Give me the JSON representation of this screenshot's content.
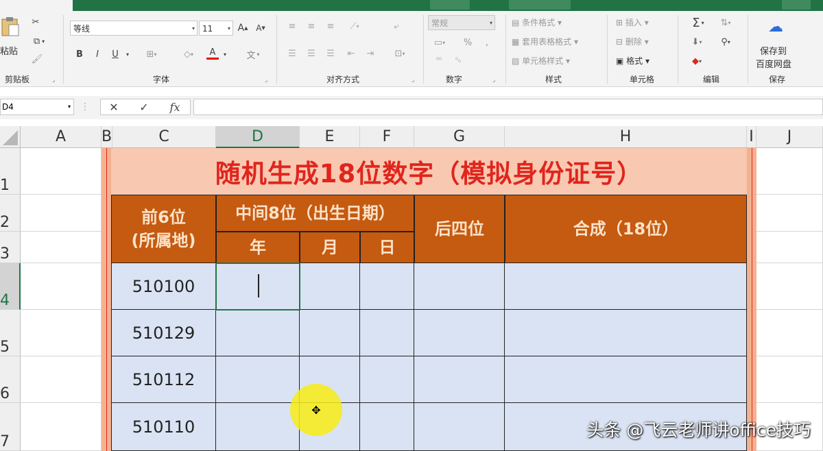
{
  "ribbon": {
    "clipboard": {
      "paste_label": "粘贴",
      "group_label": "剪贴板"
    },
    "font": {
      "font_name": "等线",
      "font_size": "11",
      "group_label": "字体",
      "bold": "B",
      "italic": "I",
      "underline": "U",
      "grow": "A",
      "shrink": "A",
      "font_color_letter": "A",
      "pinyin": "文"
    },
    "alignment": {
      "group_label": "对齐方式"
    },
    "number": {
      "format_value": "常规",
      "percent": "%",
      "comma": ",",
      "group_label": "数字"
    },
    "styles": {
      "conditional_label": "条件格式",
      "table_label": "套用表格格式",
      "cell_styles_label": "单元格样式",
      "group_label": "样式"
    },
    "cells": {
      "insert_label": "插入",
      "delete_label": "删除",
      "format_label": "格式",
      "group_label": "单元格"
    },
    "editing": {
      "sum": "Σ",
      "group_label": "编辑"
    },
    "save": {
      "line1": "保存到",
      "line2": "百度网盘",
      "group_label": "保存"
    }
  },
  "formula_bar": {
    "name_box": "D4",
    "fx": "fx",
    "cancel": "✕",
    "enter": "✓",
    "formula": ""
  },
  "columns": [
    "A",
    "B",
    "C",
    "D",
    "E",
    "F",
    "G",
    "H",
    "I",
    "J"
  ],
  "rows": [
    "1",
    "2",
    "3",
    "4",
    "5",
    "6",
    "7"
  ],
  "sheet": {
    "title": "随机生成18位数字（模拟身份证号）",
    "header_front6_line1": "前6位",
    "header_front6_line2": "(所属地)",
    "header_middle8": "中间8位（出生日期）",
    "header_year": "年",
    "header_month": "月",
    "header_day": "日",
    "header_last4": "后四位",
    "header_combined": "合成（18位）",
    "area_codes": [
      "510100",
      "510129",
      "510112",
      "510110"
    ]
  },
  "watermark": "头条 @飞云老师讲office技巧",
  "colors": {
    "accent": "#217346",
    "header_fill": "#c55a11",
    "title_fill": "#f8c8b1",
    "data_fill": "#dae3f3",
    "title_text": "#e0251d"
  }
}
